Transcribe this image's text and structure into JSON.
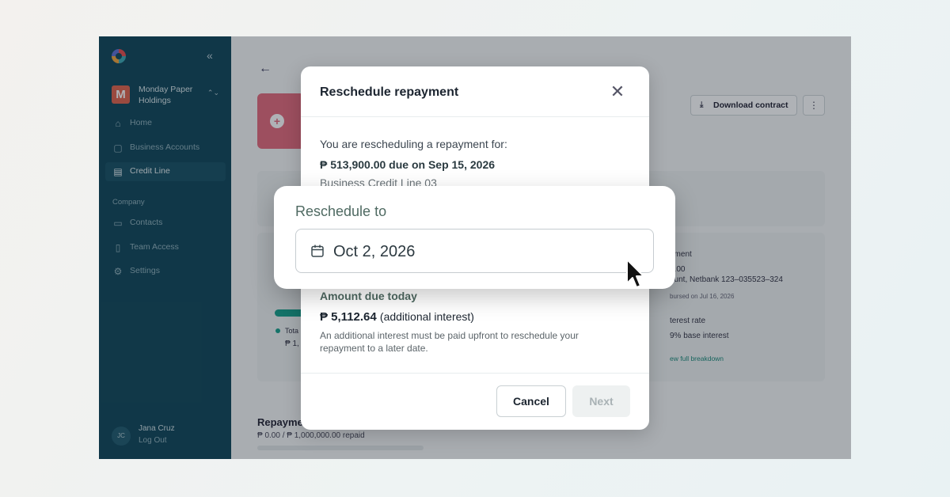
{
  "sidebar": {
    "collapse_icon": "«",
    "org": {
      "initial": "M",
      "name": "Monday Paper Holdings"
    },
    "items": [
      {
        "label": "Home",
        "icon": "home-icon"
      },
      {
        "label": "Business Accounts",
        "icon": "briefcase-icon"
      },
      {
        "label": "Credit Line",
        "icon": "credit-line-icon",
        "active": true
      }
    ],
    "section_label": "Company",
    "company_items": [
      {
        "label": "Contacts",
        "icon": "contacts-icon"
      },
      {
        "label": "Team Access",
        "icon": "team-access-icon"
      },
      {
        "label": "Settings",
        "icon": "gear-icon"
      }
    ],
    "user": {
      "initials": "JC",
      "name": "Jana Cruz",
      "logout": "Log Out"
    }
  },
  "main": {
    "download_label": "Download contract",
    "repayments": {
      "title": "Repayme",
      "sub": "₱ 0.00 / ₱ 1,000,000.00 repaid"
    },
    "bg_details": {
      "disbursement_label": "ement",
      "disbursement_amount": "0.00",
      "account": "ount, Netbank 123–035523–324",
      "disbursed": "bursed on Jul 16, 2026",
      "interest_label": "terest rate",
      "interest_value": "9% base interest",
      "breakdown_link": "ew full breakdown",
      "total_label": "Tota",
      "total_value": "₱ 1,"
    }
  },
  "modal": {
    "title": "Reschedule repayment",
    "intro": "You are rescheduling a repayment for:",
    "amount_due": "₱ 513,900.00 due on Sep 15, 2026",
    "credit_line": "Business Credit Line 03",
    "reschedule_label": "Reschedule to",
    "reschedule_value": "Oct 2, 2026",
    "amount_today_label": "Amount due today",
    "amount_today_value": "₱ 5,112.64",
    "amount_today_note": "(additional interest)",
    "help": "An additional interest must be paid upfront to reschedule your repayment to a later date.",
    "cancel_label": "Cancel",
    "next_label": "Next"
  },
  "colors": {
    "sidebar": "#0f4559",
    "accent": "#16a08a",
    "label": "#4f6a62"
  }
}
